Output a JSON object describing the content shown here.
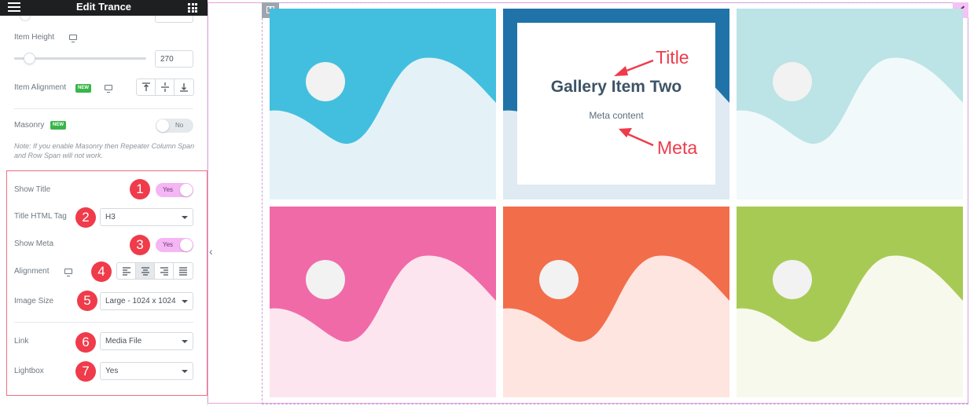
{
  "panel": {
    "title": "Edit Trance"
  },
  "controls": {
    "item_height": {
      "label": "Item Height",
      "value": "270",
      "fill": 0.1
    },
    "item_alignment": {
      "label": "Item Alignment",
      "badge": "NEW"
    },
    "masonry": {
      "label": "Masonry",
      "badge": "NEW",
      "toggle": "No"
    },
    "masonry_note": "Note: If you enable Masonry then Repeater Column Span and Row Span will not work.",
    "show_title": {
      "label": "Show Title",
      "toggle": "Yes",
      "num": "1"
    },
    "title_html_tag": {
      "label": "Title HTML Tag",
      "value": "H3",
      "num": "2"
    },
    "show_meta": {
      "label": "Show Meta",
      "toggle": "Yes",
      "num": "3"
    },
    "alignment": {
      "label": "Alignment",
      "num": "4"
    },
    "image_size": {
      "label": "Image Size",
      "value": "Large - 1024 x 1024",
      "num": "5"
    },
    "link": {
      "label": "Link",
      "value": "Media File",
      "num": "6"
    },
    "lightbox": {
      "label": "Lightbox",
      "value": "Yes",
      "num": "7"
    }
  },
  "gallery": {
    "item_title": "Gallery Item Two",
    "item_meta": "Meta content",
    "tiles": [
      {
        "bg": "#42bfde",
        "wave": "#e4f2f8"
      },
      {
        "bg": "#1f73a8",
        "wave": "#dfeaf3"
      },
      {
        "bg": "#bce3e5",
        "wave": "#f1f9fa"
      },
      {
        "bg": "#f06aa8",
        "wave": "#fde5ef"
      },
      {
        "bg": "#f26d4a",
        "wave": "#fee5df"
      },
      {
        "bg": "#a7ca55",
        "wave": "#f7f9ec"
      }
    ],
    "circle_color": "#f1f2f1"
  },
  "annotations": {
    "title": "Title",
    "meta": "Meta"
  },
  "colors": {
    "accent": "#ef3b4a",
    "toggle_on": "#f4b6f5"
  }
}
